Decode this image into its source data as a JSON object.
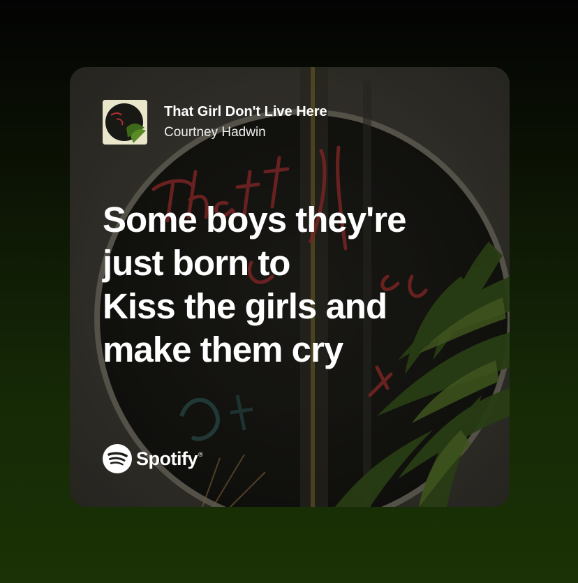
{
  "track": {
    "title": "That Girl Don't Live Here",
    "artist": "Courtney Hadwin",
    "cover_icon": "album-cover-image"
  },
  "lyrics": {
    "lines": [
      "Some boys they're",
      "just born to",
      "Kiss the girls and",
      "make them cry"
    ]
  },
  "brand": {
    "name": "Spotify",
    "registered": "®",
    "icon": "spotify-logo-icon"
  },
  "colors": {
    "card_text": "#ffffff",
    "background_top": "#030303",
    "background_bottom": "#1a3205"
  }
}
